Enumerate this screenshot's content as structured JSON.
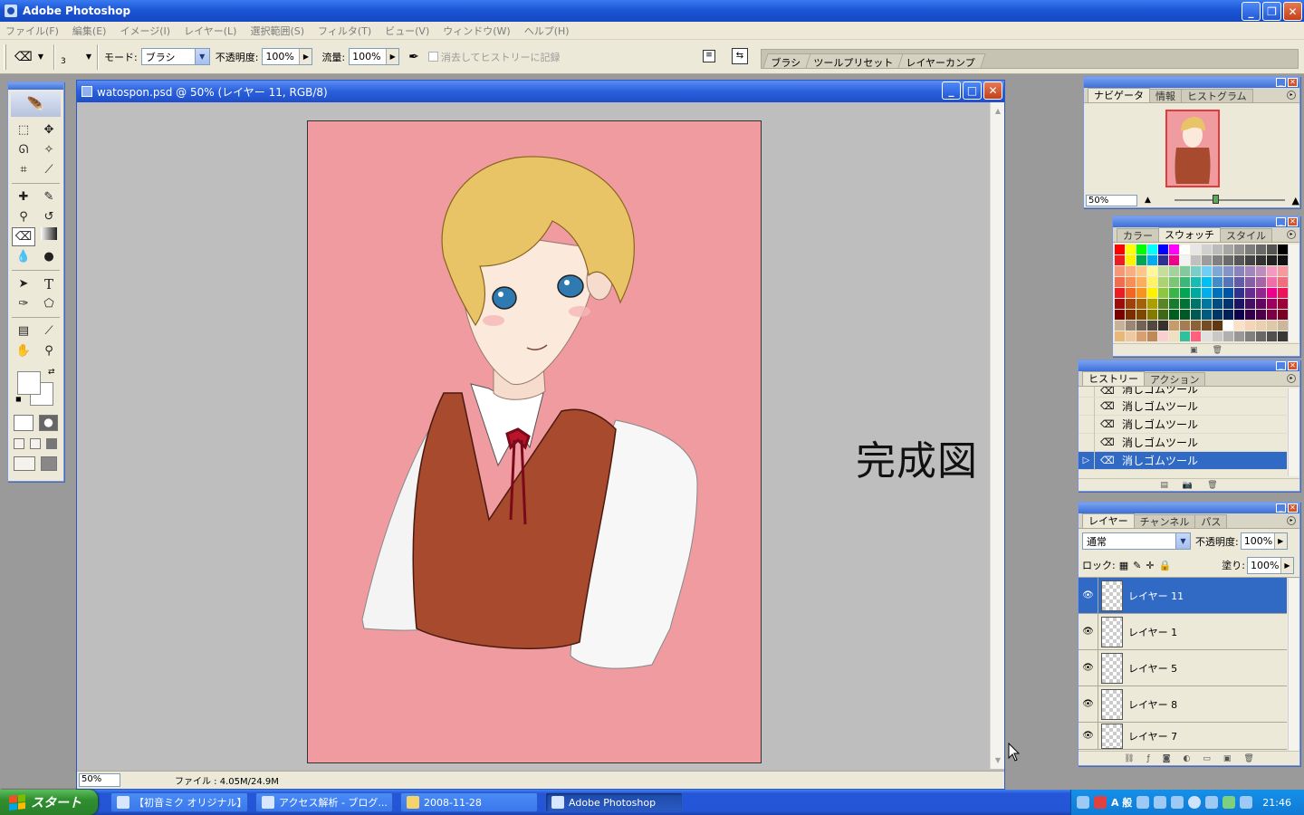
{
  "window": {
    "title": "Adobe Photoshop"
  },
  "menu": [
    "ファイル(F)",
    "編集(E)",
    "イメージ(I)",
    "レイヤー(L)",
    "選択範囲(S)",
    "フィルタ(T)",
    "ビュー(V)",
    "ウィンドウ(W)",
    "ヘルプ(H)"
  ],
  "options": {
    "brush_size": "3",
    "mode_label": "モード:",
    "mode_value": "ブラシ",
    "opacity_label": "不透明度:",
    "opacity_value": "100%",
    "flow_label": "流量:",
    "flow_value": "100%",
    "erase_history_label": "消去してヒストリーに記録"
  },
  "palette_well": [
    "ブラシ",
    "ツールプリセット",
    "レイヤーカンプ"
  ],
  "document": {
    "title": "watospon.psd @ 50% (レイヤー 11, RGB/8)",
    "zoom": "50%",
    "file_info": "ファイル : 4.05M/24.9M",
    "caption": "完成図"
  },
  "navigator": {
    "tabs": [
      "ナビゲータ",
      "情報",
      "ヒストグラム"
    ],
    "zoom": "50%"
  },
  "swatches": {
    "tabs": [
      "カラー",
      "スウォッチ",
      "スタイル"
    ],
    "colors": [
      "#ff0000",
      "#ffff00",
      "#00ff00",
      "#00ffff",
      "#0000ff",
      "#ff00ff",
      "#ffffff",
      "#e6e6e6",
      "#d0d0d0",
      "#bbbbbb",
      "#a6a6a6",
      "#919191",
      "#7d7d7d",
      "#686868",
      "#535353",
      "#000000",
      "#ed1c24",
      "#fff200",
      "#00a651",
      "#00aeef",
      "#2e3192",
      "#ec008c",
      "#f2f2f2",
      "#c0c0c0",
      "#9c9c9c",
      "#808080",
      "#6b6b6b",
      "#575757",
      "#444444",
      "#333333",
      "#222222",
      "#111111",
      "#f7977a",
      "#f9ad81",
      "#fdc68a",
      "#fff79a",
      "#c4df9b",
      "#a2d39c",
      "#82ca9d",
      "#7bcdc8",
      "#6ecff6",
      "#7ea7d8",
      "#8493ca",
      "#8882be",
      "#a187be",
      "#bc8dbf",
      "#f49ac2",
      "#f6989d",
      "#f26c4f",
      "#f68e55",
      "#fbaf5c",
      "#fff467",
      "#acd372",
      "#7cc576",
      "#3bb878",
      "#1abbb4",
      "#00bff3",
      "#438cca",
      "#5574b9",
      "#605ca8",
      "#855fa8",
      "#a763a8",
      "#f06ea9",
      "#f26d7d",
      "#ed1c24",
      "#f26522",
      "#f7941d",
      "#fff200",
      "#8dc73f",
      "#39b54a",
      "#00a651",
      "#00a99d",
      "#00aeef",
      "#0072bc",
      "#0054a6",
      "#2e3192",
      "#662d91",
      "#92278f",
      "#ec008c",
      "#ed145b",
      "#9e0b0f",
      "#a0410d",
      "#a36209",
      "#aba000",
      "#598527",
      "#197b30",
      "#007236",
      "#00746b",
      "#0076a3",
      "#004b80",
      "#003471",
      "#1b1464",
      "#440e62",
      "#630460",
      "#9e005d",
      "#9e0039",
      "#790000",
      "#7b2e00",
      "#7d4900",
      "#827b00",
      "#406618",
      "#005e20",
      "#005826",
      "#005952",
      "#005b7f",
      "#003663",
      "#002157",
      "#0d004c",
      "#32004b",
      "#4b0049",
      "#7b0046",
      "#7a0026",
      "#c7b299",
      "#998675",
      "#736357",
      "#534741",
      "#37302d",
      "#c69c6d",
      "#a67c52",
      "#8c6239",
      "#754c24",
      "#603913",
      "#ffffff",
      "#fde0c8",
      "#f5d5b8",
      "#ead0b0",
      "#dcc9a8",
      "#cbb89a",
      "#e8b878",
      "#f0c8a0",
      "#d8a070",
      "#c08858",
      "#f8d0d0",
      "#f0e0c0",
      "#30c0a0",
      "#ff6080",
      "#e0e0e0",
      "#c8c8c8",
      "#b0b0b0",
      "#989898",
      "#808080",
      "#686868",
      "#505050",
      "#383838"
    ]
  },
  "history": {
    "tabs": [
      "ヒストリー",
      "アクション"
    ],
    "items": [
      "消しゴムツール",
      "消しゴムツール",
      "消しゴムツール",
      "消しゴムツール",
      "消しゴムツール"
    ]
  },
  "layers": {
    "tabs": [
      "レイヤー",
      "チャンネル",
      "パス"
    ],
    "blend_mode": "通常",
    "opacity_label": "不透明度:",
    "opacity_value": "100%",
    "lock_label": "ロック:",
    "fill_label": "塗り:",
    "fill_value": "100%",
    "items": [
      "レイヤー 11",
      "レイヤー 1",
      "レイヤー 5",
      "レイヤー 8",
      "レイヤー 7"
    ]
  },
  "taskbar": {
    "start_label": "スタート",
    "tasks": [
      "【初音ミク オリジナル】...",
      "アクセス解析 - ブログ...",
      "2008-11-28",
      "Adobe Photoshop"
    ],
    "tray_text": "A 般",
    "clock": "21:46"
  },
  "colors": {
    "canvas_bg": "#ef9ba0",
    "selection": "#316ac5",
    "xp_blue": "#245edb"
  }
}
